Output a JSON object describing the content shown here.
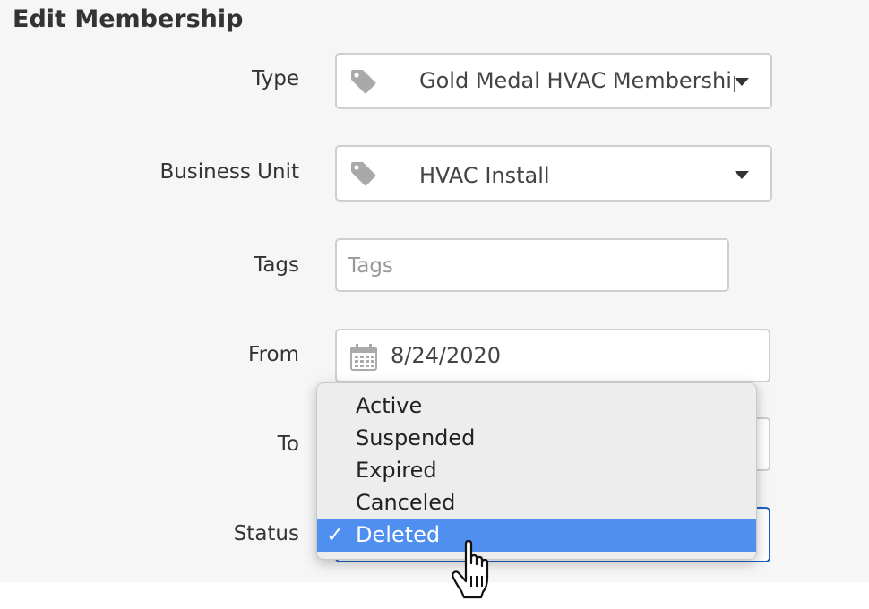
{
  "title": "Edit Membership",
  "form": {
    "type": {
      "label": "Type",
      "value": "Gold Medal HVAC Membership",
      "icon": "tag-icon"
    },
    "business_unit": {
      "label": "Business Unit",
      "value": "HVAC Install",
      "icon": "tag-icon"
    },
    "tags": {
      "label": "Tags",
      "placeholder": "Tags"
    },
    "from": {
      "label": "From",
      "value": "8/24/2020",
      "icon": "calendar-icon"
    },
    "to": {
      "label": "To"
    },
    "status": {
      "label": "Status"
    }
  },
  "status_menu": {
    "options": [
      "Active",
      "Suspended",
      "Expired",
      "Canceled",
      "Deleted"
    ],
    "selected": "Deleted",
    "check": "✓"
  },
  "colors": {
    "selection": "#4f8ff0",
    "focus_border": "#1f5fc4"
  }
}
